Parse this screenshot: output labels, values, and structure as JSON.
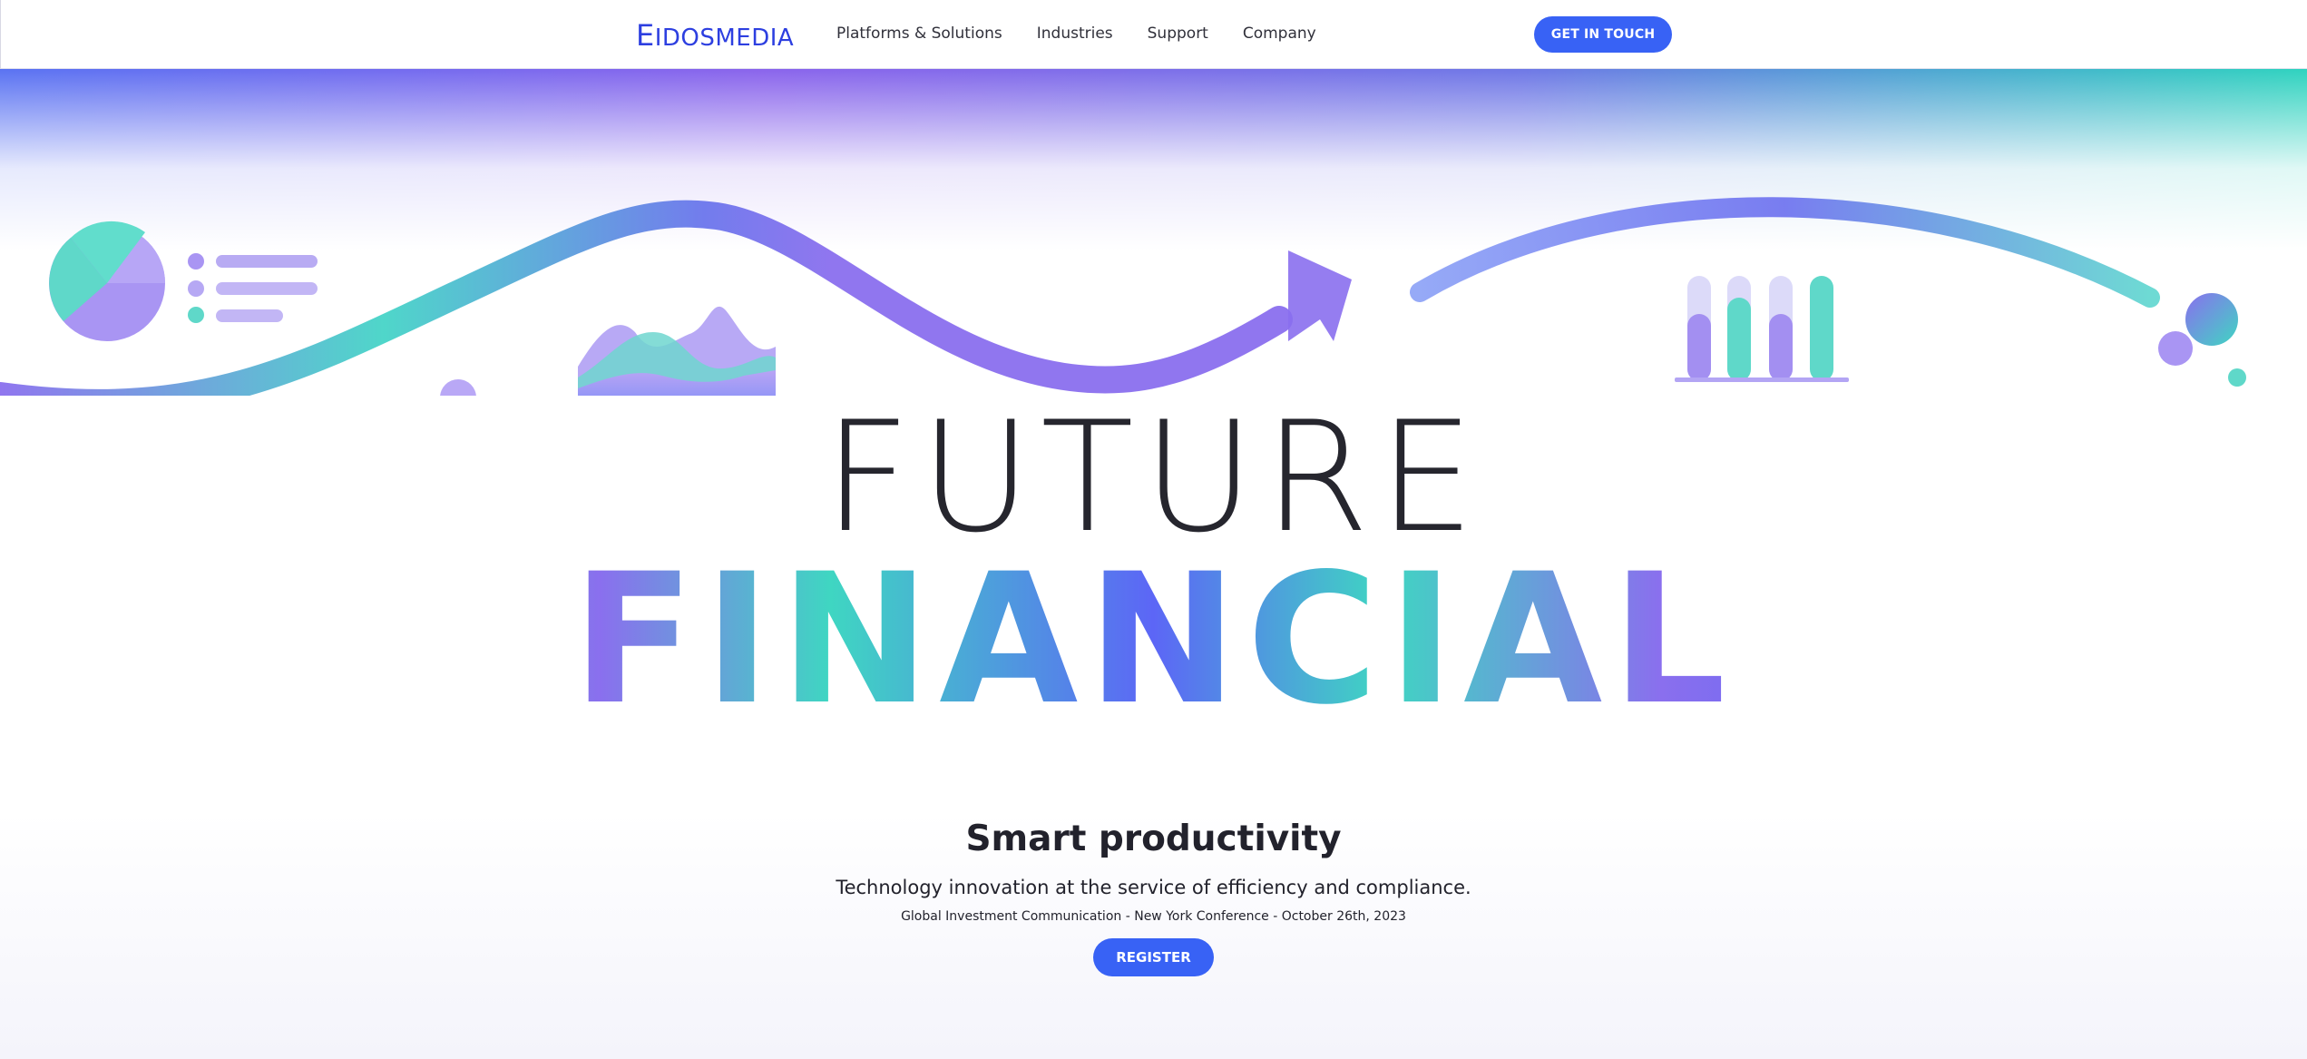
{
  "header": {
    "logo_first": "E",
    "logo_rest": "IDOSMEDIA",
    "nav": [
      {
        "label": "Platforms & Solutions"
      },
      {
        "label": "Industries"
      },
      {
        "label": "Support"
      },
      {
        "label": "Company"
      }
    ],
    "cta_label": "GET IN TOUCH"
  },
  "hero": {
    "title_line1": "FUTURE",
    "title_line2": "FINANCIAL",
    "heading": "Smart productivity",
    "subheading": "Technology innovation at the service of efficiency and compliance.",
    "event": "Global Investment Communication - New York Conference - October 26th, 2023",
    "register_label": "REGISTER"
  },
  "colors": {
    "accent": "#3862f5",
    "purple": "#8a6fee",
    "teal": "#3fd6c2",
    "blue": "#4f64f7"
  },
  "icons": [
    "pie-chart-icon",
    "area-chart-icon",
    "bar-chart-icon",
    "trend-arrow-icon"
  ]
}
